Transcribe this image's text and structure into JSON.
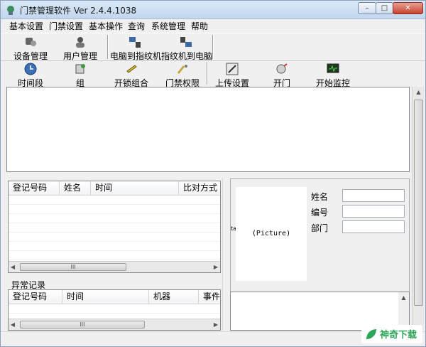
{
  "window": {
    "title": "门禁管理软件  Ver 2.4.4.1038",
    "controls": {
      "minimize": "–",
      "maximize": "□",
      "close": "✕"
    }
  },
  "menu": [
    "基本设置",
    "门禁设置",
    "基本操作",
    "查询",
    "系统管理",
    "帮助"
  ],
  "toolbar_primary": [
    {
      "label": "设备管理",
      "icon": "device-icon"
    },
    {
      "label": "用户管理",
      "icon": "user-icon"
    },
    {
      "label": "电脑到指纹机",
      "icon": "pc-to-device-icon"
    },
    {
      "label": "指纹机到电脑",
      "icon": "device-to-pc-icon"
    }
  ],
  "toolbar_secondary": [
    {
      "label": "时间段",
      "icon": "clock-icon"
    },
    {
      "label": "组",
      "icon": "group-icon"
    },
    {
      "label": "开锁组合",
      "icon": "unlock-combo-icon"
    },
    {
      "label": "门禁权限",
      "icon": "access-permission-icon"
    },
    {
      "label": "上传设置",
      "icon": "upload-icon"
    },
    {
      "label": "开门",
      "icon": "open-door-icon"
    },
    {
      "label": "开始监控",
      "icon": "monitor-icon"
    }
  ],
  "records_grid": {
    "columns": [
      "登记号码",
      "姓名",
      "时间",
      "比对方式"
    ],
    "scroll_thumb": "III"
  },
  "abnormal_records": {
    "title": "异常记录",
    "columns": [
      "登记号码",
      "时间",
      "机器",
      "事件"
    ],
    "scroll_thumb": "III"
  },
  "person_panel": {
    "picture_text": "(Picture)",
    "picture_side_mark": "ta",
    "fields": [
      {
        "label": "姓名",
        "value": ""
      },
      {
        "label": "编号",
        "value": ""
      },
      {
        "label": "部门",
        "value": ""
      }
    ]
  },
  "watermark": "神奇下载",
  "colors": {
    "titlebar": "#c2d6ee",
    "close": "#c7432f",
    "watermark": "#2fa55a"
  }
}
